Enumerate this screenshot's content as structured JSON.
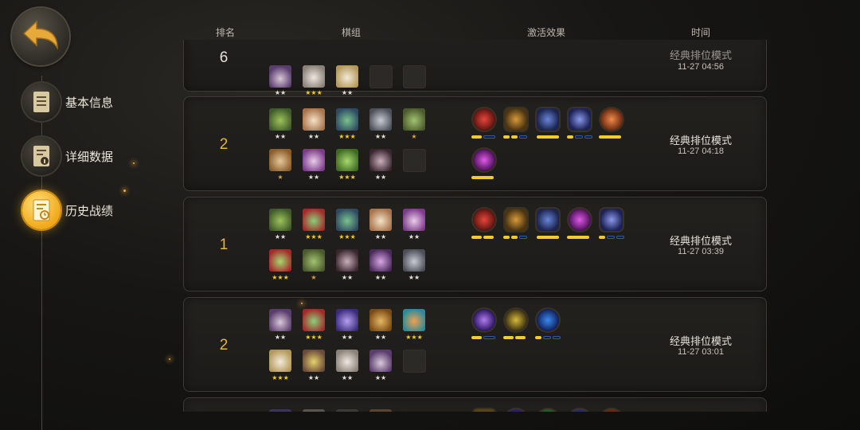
{
  "sidebar": {
    "items": [
      {
        "label": "基本信息"
      },
      {
        "label": "详细数据"
      },
      {
        "label": "历史战绩"
      }
    ]
  },
  "header": {
    "rank": "排名",
    "lineup": "棋组",
    "traits": "激活效果",
    "time": "时间"
  },
  "records": [
    {
      "rank": "6",
      "mode": "经典排位模式",
      "time": "11-27 04:56"
    },
    {
      "rank": "2",
      "mode": "经典排位模式",
      "time": "11-27 04:18"
    },
    {
      "rank": "1",
      "mode": "经典排位模式",
      "time": "11-27 03:39"
    },
    {
      "rank": "2",
      "mode": "经典排位模式",
      "time": "11-27 03:01"
    }
  ],
  "colors": {
    "accent": "#f1cc2b",
    "rank_gold": "#e8b53a",
    "active_nav": "#f0a81a"
  }
}
